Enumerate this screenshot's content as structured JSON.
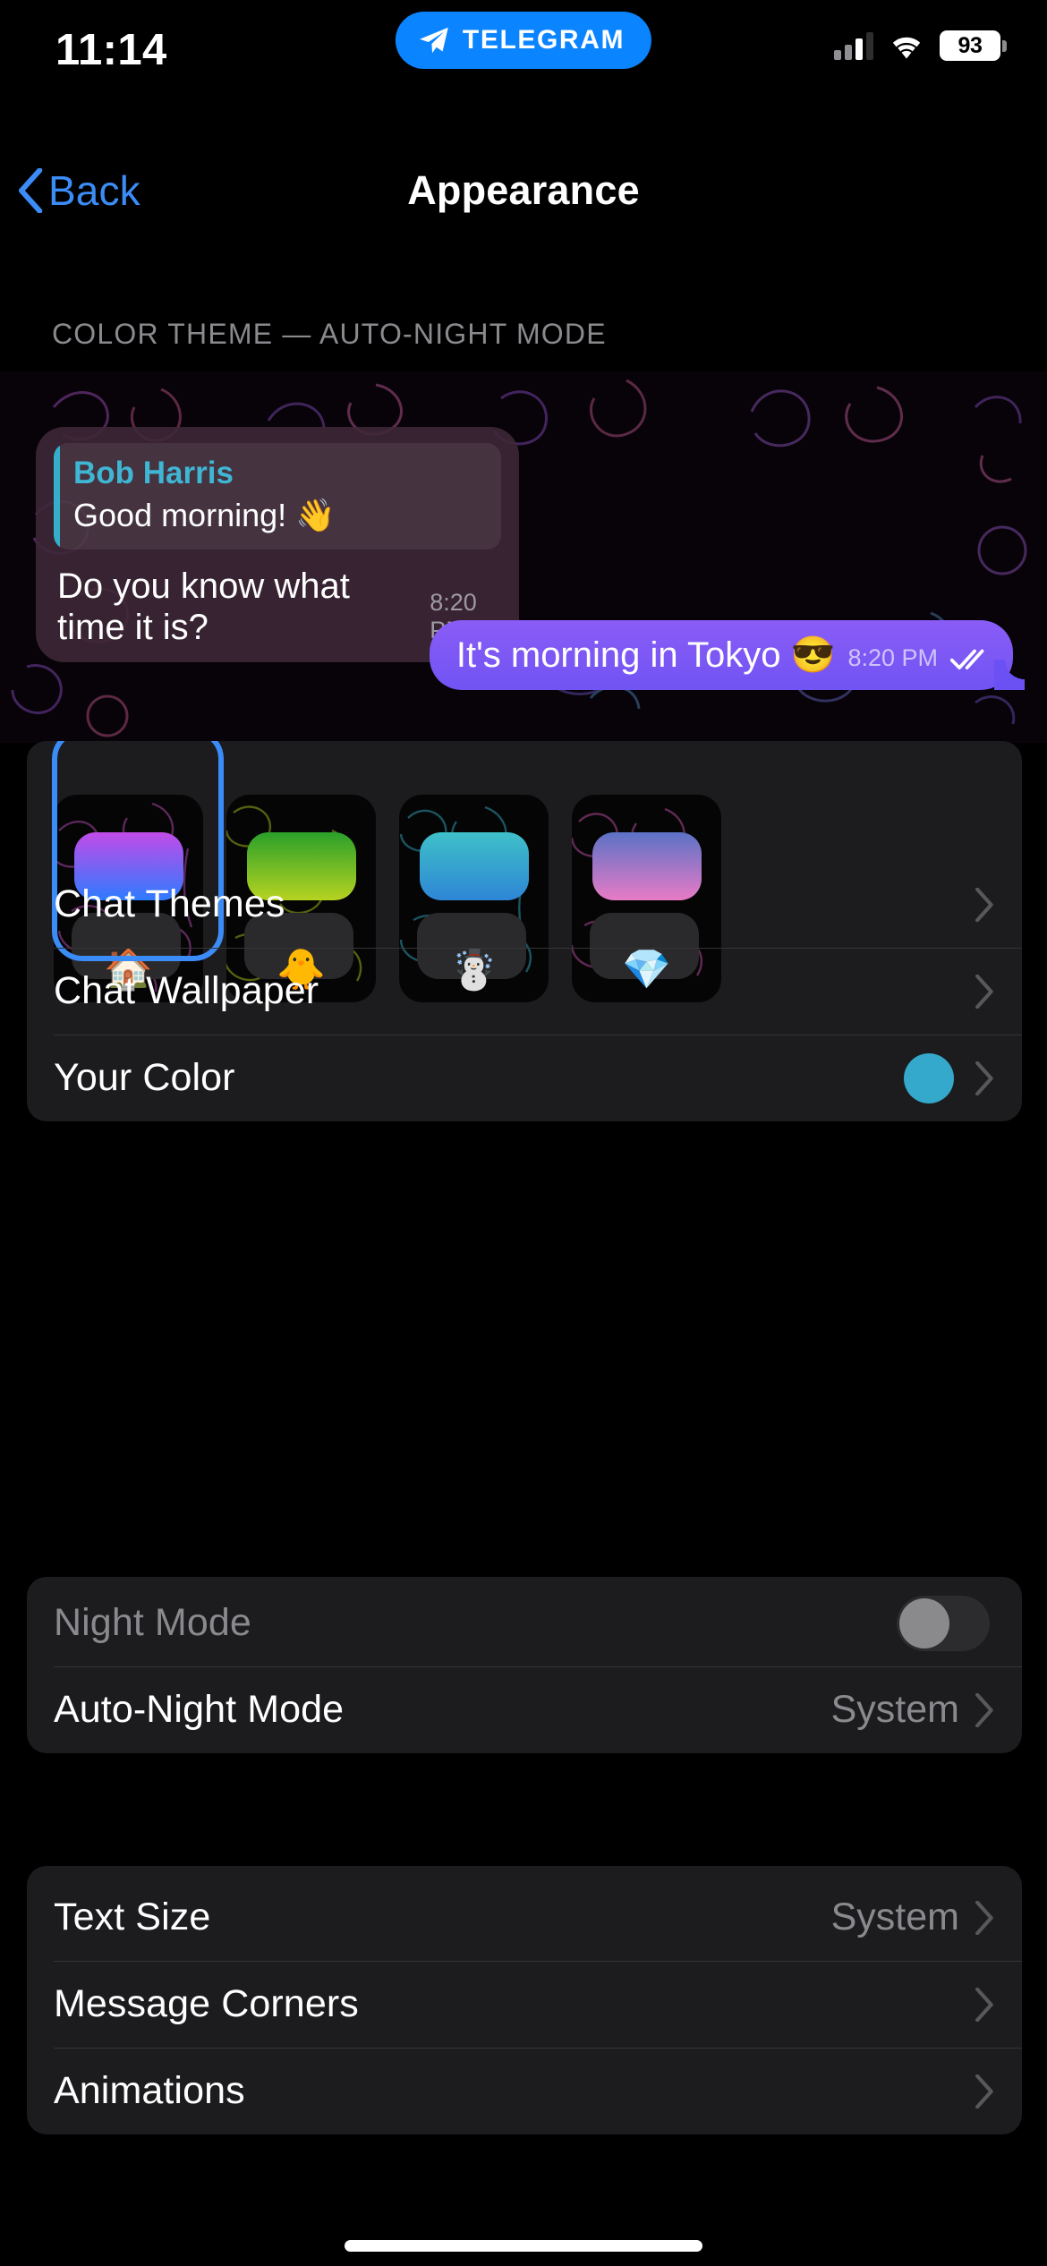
{
  "status_bar": {
    "time": "11:14",
    "app_badge": "TELEGRAM",
    "battery_percent": "93",
    "icons": [
      "telegram-plane-icon",
      "cellular-signal-icon",
      "wifi-icon",
      "battery-icon"
    ]
  },
  "nav": {
    "back_label": "Back",
    "title": "Appearance"
  },
  "section_header": "COLOR THEME — AUTO-NIGHT MODE",
  "chat_preview": {
    "incoming": {
      "quote_name": "Bob Harris",
      "quote_text": "Good morning! 👋",
      "text": "Do you know what time it is?",
      "time": "8:20 PM"
    },
    "outgoing": {
      "text": "It's morning in Tokyo 😎",
      "time": "8:20 PM",
      "status_icon": "double-check-icon"
    }
  },
  "themes": {
    "selected_index": 0,
    "items": [
      {
        "name": "home",
        "emoji": "🏠",
        "gradient_from": "#C24BE8",
        "gradient_to": "#2E7BFF",
        "doodle_color": "#6E2F6B",
        "selected": true
      },
      {
        "name": "chick",
        "emoji": "🐥",
        "gradient_from": "#2AA02A",
        "gradient_to": "#B7D321",
        "doodle_color": "#5E6B12",
        "selected": false
      },
      {
        "name": "snowman",
        "emoji": "☃️",
        "gradient_from": "#3FC0C9",
        "gradient_to": "#2E86D6",
        "doodle_color": "#1E5E6B",
        "selected": false
      },
      {
        "name": "gem",
        "emoji": "💎",
        "gradient_from": "#5B72C6",
        "gradient_to": "#E87BC6",
        "doodle_color": "#6B2F5E",
        "selected": false
      }
    ]
  },
  "theme_rows": [
    {
      "label": "Chat Themes",
      "accessory": "chevron"
    },
    {
      "label": "Chat Wallpaper",
      "accessory": "chevron"
    },
    {
      "label": "Your Color",
      "accessory": "color-dot-chevron",
      "color": "#34A9CB"
    }
  ],
  "night_rows": [
    {
      "label": "Night Mode",
      "accessory": "toggle",
      "toggle_on": false,
      "disabled": true
    },
    {
      "label": "Auto-Night Mode",
      "accessory": "value-chevron",
      "value": "System"
    }
  ],
  "text_rows": [
    {
      "label": "Text Size",
      "accessory": "value-chevron",
      "value": "System"
    },
    {
      "label": "Message Corners",
      "accessory": "chevron"
    },
    {
      "label": "Animations",
      "accessory": "chevron"
    }
  ],
  "colors": {
    "accent_blue": "#3C8CF7",
    "outgoing_bubble": "#7B5CF5",
    "card_background": "#1C1C1E",
    "your_color": "#34A9CB"
  }
}
